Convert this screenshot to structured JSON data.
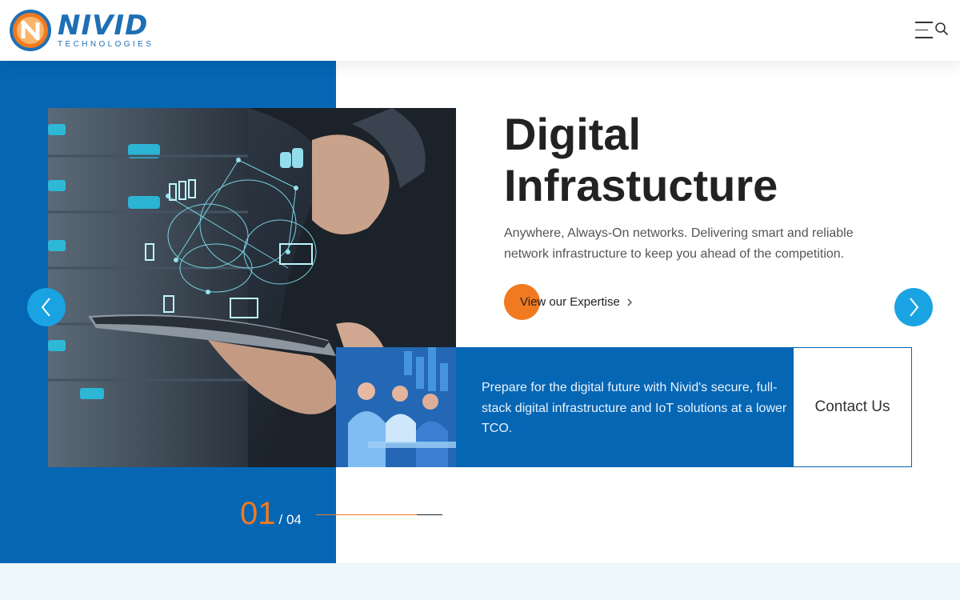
{
  "brand": {
    "name": "NIVID",
    "tagline": "TECHNOLOGIES",
    "accent": "#1f6fb5",
    "logo_ring": "#f07a1f"
  },
  "header": {
    "menu_icon": "hamburger-menu-icon",
    "search_icon": "search-icon"
  },
  "hero": {
    "title_line1": "Digital",
    "title_line2": "Infrastucture",
    "description": "Anywhere, Always-On networks. Delivering smart and reliable network infrastructure to keep you ahead of the competition.",
    "cta_label": "View our Expertise",
    "cta_icon": "chevron-right-icon"
  },
  "band": {
    "text": "Prepare for the digital future with Nivid's secure, full-stack digital infrastructure and IoT solutions at a lower TCO.",
    "contact_label": "Contact Us"
  },
  "slider": {
    "current": "01",
    "total": "/ 04",
    "progress": 0.8,
    "prev_icon": "chevron-left-icon",
    "next_icon": "chevron-right-icon"
  },
  "colors": {
    "primary_blue": "#0566b4",
    "orange": "#f07a1f",
    "arrow_blue": "#1aa3e3",
    "strip": "#eef7fc"
  }
}
